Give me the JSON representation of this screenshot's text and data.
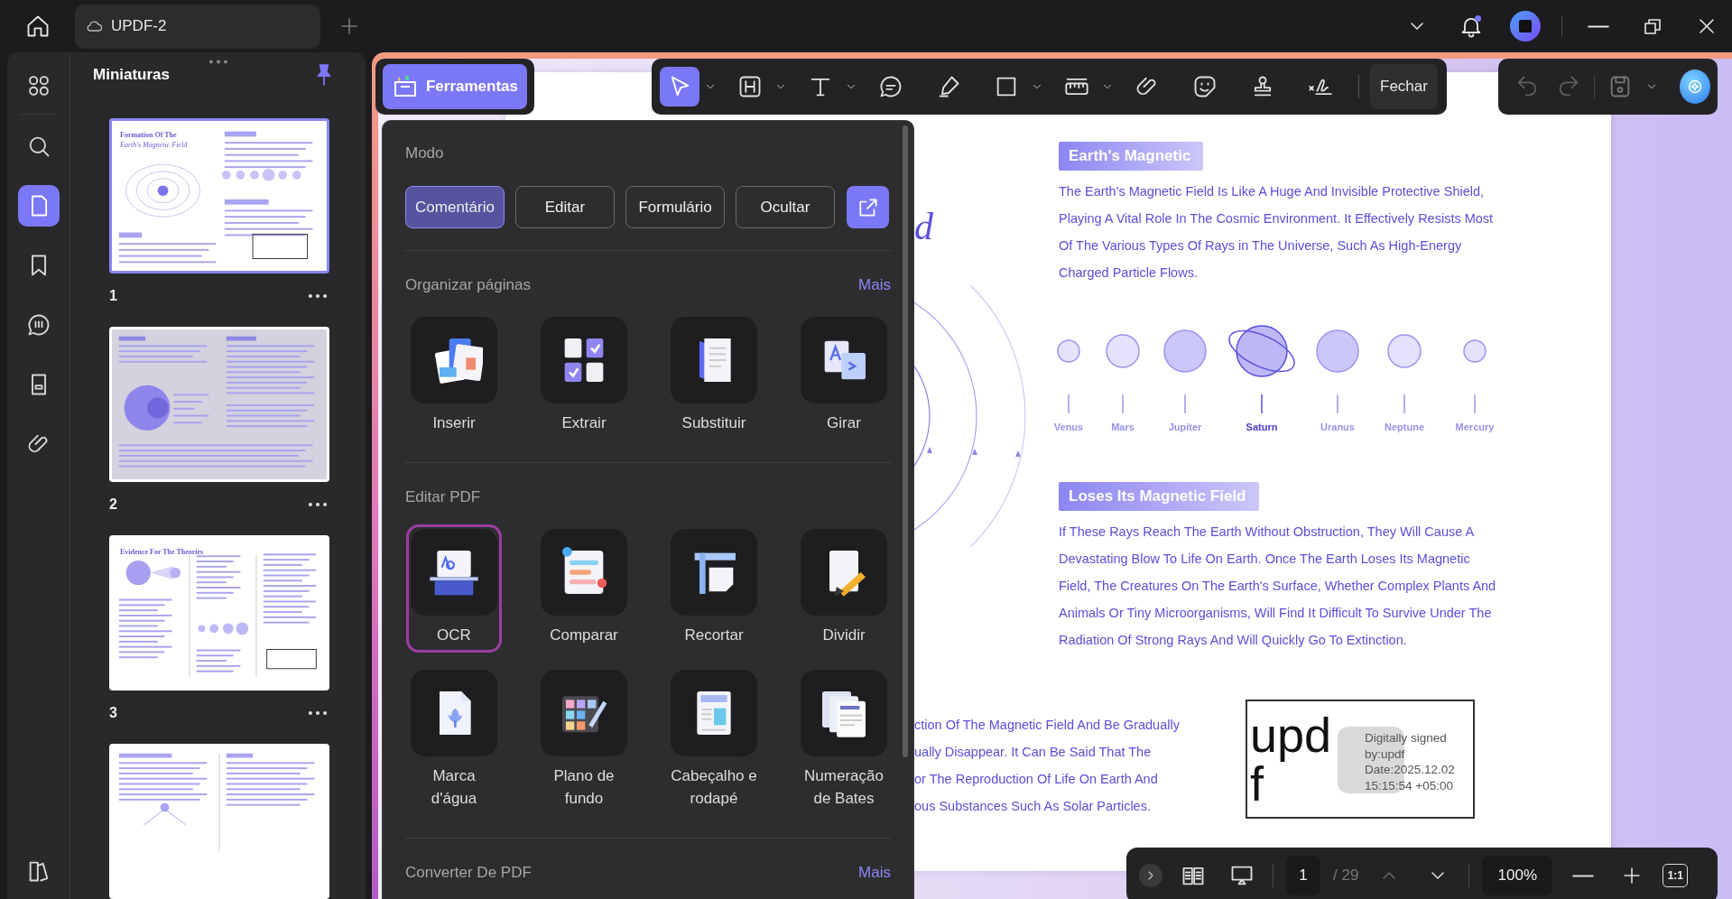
{
  "titlebar": {
    "tab": {
      "title": "UPDF-2"
    },
    "notifications": {
      "unread": true
    }
  },
  "rail": {
    "items": [
      {
        "kind": "grid",
        "selected": false
      },
      {
        "kind": "search",
        "selected": false
      },
      {
        "kind": "pages",
        "selected": true
      },
      {
        "kind": "bookmark",
        "selected": false
      },
      {
        "kind": "comments",
        "selected": false
      },
      {
        "kind": "form",
        "selected": false
      },
      {
        "kind": "attachment",
        "selected": false
      },
      {
        "kind": "reader",
        "selected": false
      }
    ]
  },
  "thumbnails": {
    "title": "Miniaturas",
    "pinned": true,
    "pages": [
      {
        "label": "1",
        "selected": true,
        "kind": "rings",
        "heading": [
          "Formation Of The",
          "Earth's Magnetic Field"
        ]
      },
      {
        "label": "2",
        "selected": false,
        "kind": "globe"
      },
      {
        "label": "3",
        "selected": false,
        "kind": "planets",
        "heading": [
          "Evidence For The Theories"
        ]
      },
      {
        "selected": false,
        "kind": "tree"
      }
    ]
  },
  "toolbar": {
    "tools_button": "Ferramentas",
    "tools": [
      {
        "kind": "select",
        "selected": true,
        "dropdown": true
      },
      {
        "kind": "heading",
        "selected": false,
        "dropdown": true
      },
      {
        "kind": "text",
        "selected": false,
        "dropdown": true
      },
      {
        "kind": "comment",
        "selected": false,
        "dropdown": false
      },
      {
        "kind": "highlighter",
        "selected": false,
        "dropdown": false
      },
      {
        "kind": "rectangle",
        "selected": false,
        "dropdown": true
      },
      {
        "kind": "ruler",
        "selected": false,
        "dropdown": true
      },
      {
        "kind": "paperclip",
        "selected": false,
        "dropdown": false
      },
      {
        "kind": "sticker",
        "selected": false,
        "dropdown": false
      },
      {
        "kind": "stamp",
        "selected": false,
        "dropdown": false
      },
      {
        "kind": "signature",
        "selected": false,
        "dropdown": false
      }
    ],
    "close_button": "Fechar",
    "history": [
      {
        "kind": "undo",
        "disabled": true
      },
      {
        "kind": "redo",
        "disabled": true
      }
    ]
  },
  "tools_panel": {
    "mode_title": "Modo",
    "modes": [
      {
        "label": "Comentário",
        "selected": true
      },
      {
        "label": "Editar",
        "selected": false
      },
      {
        "label": "Formulário",
        "selected": false
      },
      {
        "label": "Ocultar",
        "selected": false
      }
    ],
    "sections": [
      {
        "title": "Organizar páginas",
        "more": "Mais",
        "items": [
          {
            "label": "Inserir",
            "kind": "insert",
            "selected": false
          },
          {
            "label": "Extrair",
            "kind": "extract",
            "selected": false
          },
          {
            "label": "Substituir",
            "kind": "replace",
            "selected": false
          },
          {
            "label": "Girar",
            "kind": "rotate",
            "selected": false
          }
        ]
      },
      {
        "title": "Editar PDF",
        "items": [
          {
            "label": "OCR",
            "kind": "ocr",
            "selected": true
          },
          {
            "label": "Comparar",
            "kind": "compare",
            "selected": false
          },
          {
            "label": "Recortar",
            "kind": "crop",
            "selected": false
          },
          {
            "label": "Dividir",
            "kind": "split",
            "selected": false
          },
          {
            "label": "Marca d'água",
            "kind": "watermark",
            "selected": false
          },
          {
            "label": "Plano de fundo",
            "kind": "background",
            "selected": false
          },
          {
            "label": "Cabeçalho e rodapé",
            "kind": "header_footer",
            "selected": false
          },
          {
            "label": "Numeração de Bates",
            "kind": "bates",
            "selected": false
          }
        ]
      },
      {
        "title": "Converter De PDF",
        "more": "Mais"
      }
    ]
  },
  "document": {
    "title_tail": "d",
    "sections": [
      {
        "title": "Earth's Magnetic",
        "lines": [
          "The Earth's Magnetic Field Is Like A Huge And Invisible Protective Shield,",
          "Playing A Vital Role In The Cosmic Environment. It Effectively Resists Most",
          "Of The Various Types Of Rays in The Universe, Such As High-Energy",
          "Charged Particle Flows."
        ]
      },
      {
        "title": "Loses Its Magnetic Field",
        "lines": [
          "If These Rays Reach The Earth Without Obstruction, They Will Cause A",
          "Devastating Blow To Life On Earth. Once The Earth Loses Its Magnetic",
          "Field, The Creatures On The Earth's Surface, Whether Complex Plants And",
          "Animals Or Tiny Microorganisms, Will Find It Difficult To Survive Under The",
          "Radiation Of Strong Rays And Will Quickly Go To Extinction."
        ]
      }
    ],
    "planets": [
      {
        "name": "Venus",
        "ringed": false,
        "highlighted": false
      },
      {
        "name": "Mars",
        "ringed": false,
        "highlighted": false
      },
      {
        "name": "Jupiter",
        "ringed": false,
        "highlighted": false
      },
      {
        "name": "Saturn",
        "ringed": true,
        "highlighted": true
      },
      {
        "name": "Uranus",
        "ringed": false,
        "highlighted": false
      },
      {
        "name": "Neptune",
        "ringed": false,
        "highlighted": false
      },
      {
        "name": "Mercury",
        "ringed": false,
        "highlighted": false
      }
    ],
    "cut_lines": [
      "ction Of The Magnetic Field And Be Gradually",
      "ually Disappear. It Can Be Said That The",
      "or The Reproduction Of Life On Earth And",
      "ous Substances Such As Solar Particles."
    ],
    "signature": {
      "logo": [
        "upd",
        "f"
      ],
      "lines": [
        "Digitally signed",
        "by:updf",
        "Date:2025.12.02",
        "15:15:54 +05:00"
      ]
    }
  },
  "viewer_bar": {
    "page": "1",
    "total": "/ 29",
    "zoom": "100%",
    "actual_size": "1:1"
  }
}
